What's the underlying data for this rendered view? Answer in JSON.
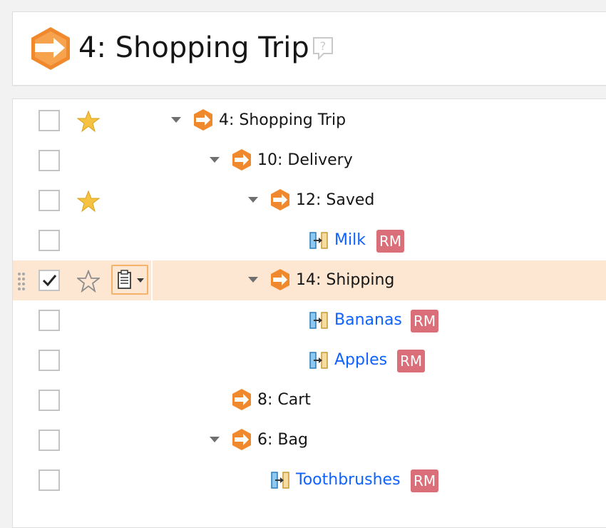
{
  "header": {
    "title": "4: Shopping Trip",
    "icon": "arrow-hexagon-icon",
    "help_icon": "help-question-icon"
  },
  "colors": {
    "accent_orange": "#f0892d",
    "selection_bg": "#fde7d2",
    "link_blue": "#0f62fe",
    "badge_red": "#da6e79",
    "star_gold": "#f5c242"
  },
  "tree": {
    "rows": [
      {
        "label": "4: Shopping Trip",
        "type": "folder",
        "starred": true,
        "checked": false,
        "depth": 0
      },
      {
        "label": "10: Delivery",
        "type": "folder",
        "starred": false,
        "checked": false,
        "depth": 1
      },
      {
        "label": "12: Saved",
        "type": "folder",
        "starred": true,
        "checked": false,
        "depth": 2
      },
      {
        "label": "Milk",
        "type": "item",
        "badge": "RM",
        "starred": false,
        "checked": false,
        "depth": 3
      },
      {
        "label": "14: Shipping",
        "type": "folder",
        "starred": false,
        "checked": true,
        "selected": true,
        "depth": 2
      },
      {
        "label": "Bananas",
        "type": "item",
        "badge": "RM",
        "starred": false,
        "checked": false,
        "depth": 3
      },
      {
        "label": "Apples",
        "type": "item",
        "badge": "RM",
        "starred": false,
        "checked": false,
        "depth": 3
      },
      {
        "label": "8: Cart",
        "type": "folder",
        "starred": false,
        "checked": false,
        "depth": 1
      },
      {
        "label": "6: Bag",
        "type": "folder",
        "starred": false,
        "checked": false,
        "depth": 1
      },
      {
        "label": "Toothbrushes",
        "type": "item",
        "badge": "RM",
        "starred": false,
        "checked": false,
        "depth": 2
      }
    ]
  }
}
